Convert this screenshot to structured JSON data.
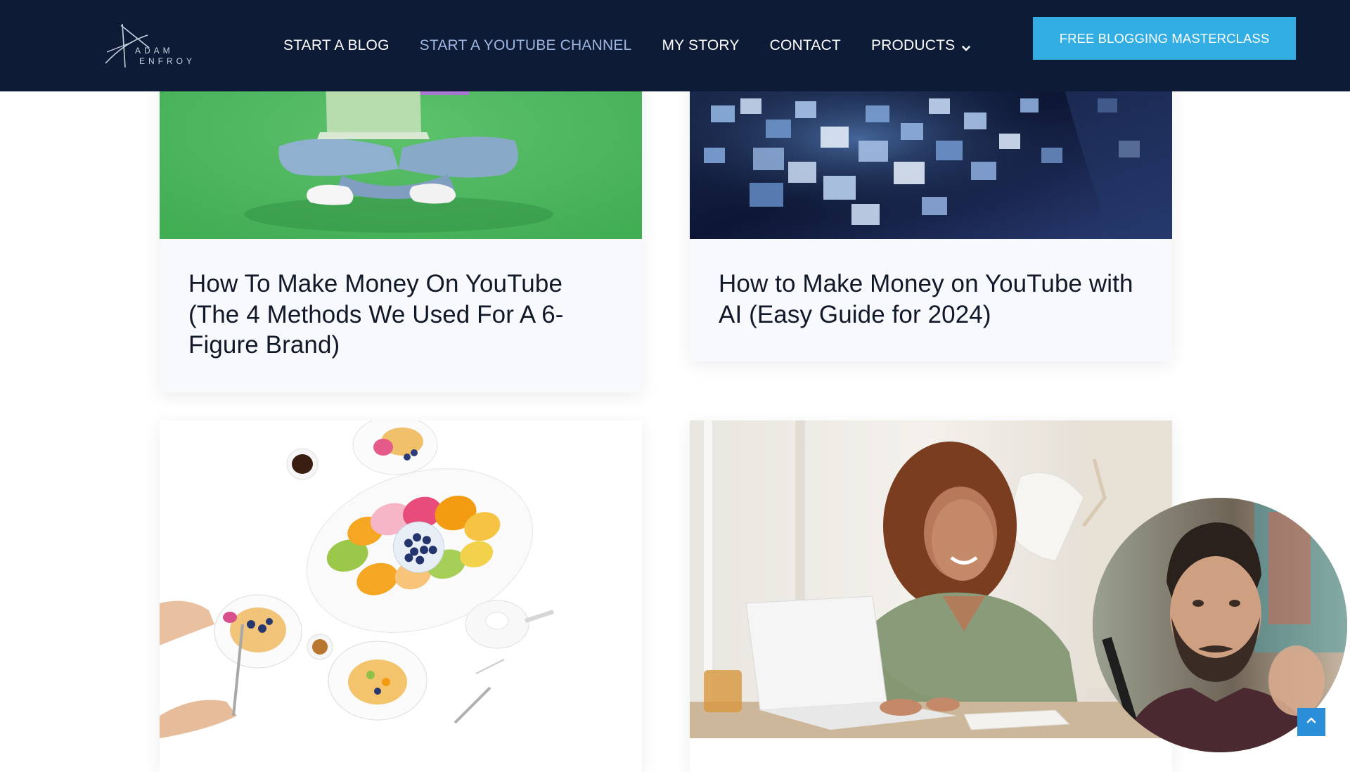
{
  "header": {
    "logo_line1": "ADAM",
    "logo_line2": "ENFROY",
    "nav": [
      {
        "label": "START A BLOG",
        "active": false
      },
      {
        "label": "START A YOUTUBE CHANNEL",
        "active": true
      },
      {
        "label": "MY STORY",
        "active": false
      },
      {
        "label": "CONTACT",
        "active": false
      },
      {
        "label": "PRODUCTS",
        "active": false,
        "icon": "chevron-down-icon"
      }
    ],
    "cta_label": "FREE BLOGGING MASTERCLASS"
  },
  "posts": [
    {
      "title": "How To Make Money On YouTube (The 4 Methods We Used For A 6-Figure Brand)",
      "image": "person-with-laptop-green-background"
    },
    {
      "title": "How to Make Money on YouTube with AI (Easy Guide for 2024)",
      "image": "floating-video-thumbnails"
    },
    {
      "title": "",
      "image": "food-platter-table"
    },
    {
      "title": "",
      "image": "woman-smiling-at-laptop"
    }
  ],
  "overlay": {
    "webcam": "presenter-webcam",
    "scroll_top_icon": "arrow-up-icon"
  },
  "colors": {
    "header_bg": "#0d1b36",
    "nav_active": "#9fb8e3",
    "cta_bg": "#33aee3",
    "card_bg": "#f7f9fc",
    "scroll_top_bg": "#2b8ed8"
  }
}
